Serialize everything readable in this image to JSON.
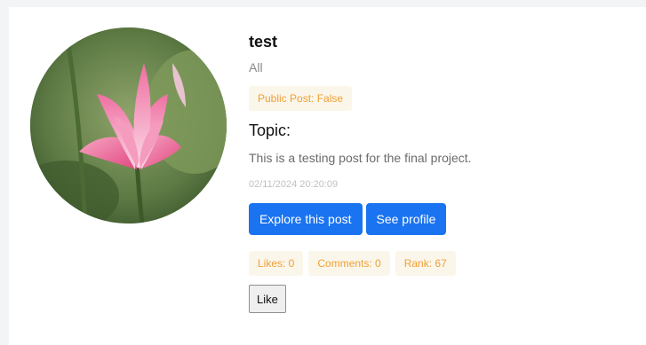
{
  "post": {
    "title": "test",
    "category": "All",
    "public_label": "Public Post: False",
    "topic_heading": "Topic:",
    "description": "This is a testing post for the final project.",
    "timestamp": "02/11/2024 20:20:09",
    "image_icon": "lotus-flower-image"
  },
  "actions": {
    "explore_label": "Explore this post",
    "profile_label": "See profile",
    "like_label": "Like"
  },
  "stats": {
    "likes": "Likes: 0",
    "comments": "Comments: 0",
    "rank": "Rank: 67"
  },
  "colors": {
    "primary": "#1a73f0",
    "badge_bg": "#fbf6ea",
    "badge_text": "#f0a035"
  }
}
